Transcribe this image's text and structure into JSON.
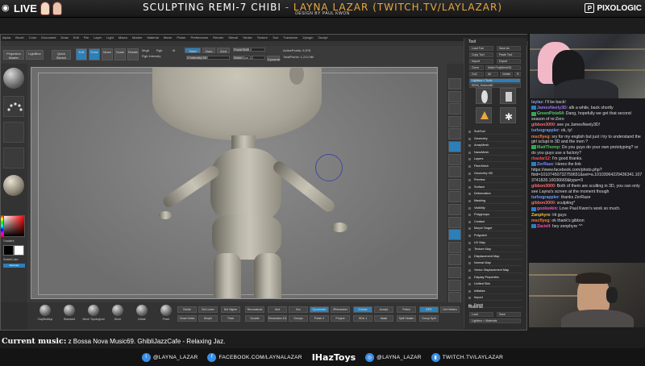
{
  "banner": {
    "live": "LIVE",
    "title_main": "SCULPTING REMI-7 CHIBI",
    "title_sep": " - ",
    "title_artist": "LAYNA LAZAR (TWITCH.TV/LAYLAZAR)",
    "subtitle": "DESIGN BY PAUL KWON",
    "sponsor": "PIXOLOGIC"
  },
  "zbrush": {
    "menu": [
      "Alpha",
      "Brush",
      "Color",
      "Document",
      "Draw",
      "Edit",
      "File",
      "Layer",
      "Light",
      "Macro",
      "Marker",
      "Material",
      "Movie",
      "Picker",
      "Preferences",
      "Render",
      "Stencil",
      "Stroke",
      "Texture",
      "Tool",
      "Transform",
      "Zplugin",
      "Zscript"
    ],
    "toolbar": {
      "projection_master": "Projection Master",
      "lightbox": "LightBox",
      "quick_sketch": "Quick Sketch",
      "edit": "Edit",
      "draw": "Draw",
      "move": "Move",
      "scale": "Scale",
      "rotate": "Rotate",
      "mrgb": "Mrgb",
      "rgb": "Rgb",
      "m": "M",
      "zadd": "Zadd",
      "zsub": "Zsub",
      "zcut": "Zcut",
      "rgb_intensity": "Rgb Intensity",
      "z_intensity": "Z Intensity 50",
      "focal_shift": "Focal Shift 0",
      "draw_size": "Draw Size 22",
      "dynamic": "Dynamic",
      "active_points": "ActivePoints: 5,578",
      "total_points": "TotalPoints: 1,212 Mil"
    },
    "tool_palette": {
      "title": "Tool",
      "buttons": [
        "Load Tool",
        "Save As",
        "Copy Tool",
        "Paste Tool",
        "Import",
        "Export",
        "Clone",
        "Make PolyMesh3D",
        "GoZ",
        "All",
        "Visible",
        "R",
        "Lightbox > Tools",
        "REMI_Subtool80"
      ],
      "items": [
        "SubTool",
        "Geometry",
        "ArrayMesh",
        "NanoMesh",
        "Layers",
        "FiberMesh",
        "Geometry HD",
        "Preview",
        "Surface",
        "Deformation",
        "Masking",
        "Visibility",
        "Polygroups",
        "Contact",
        "Morph Target",
        "Polypaint",
        "UV Map",
        "Texture Map",
        "Displacement Map",
        "Normal Map",
        "Vector Displacement Map",
        "Display Properties",
        "Unified Skin",
        "Initialize",
        "Import",
        "Export"
      ],
      "material_title": "Material",
      "material_buttons": [
        "Load",
        "Save",
        "Lightbox > Materials"
      ]
    },
    "left_tray": {
      "gradient": "Gradient",
      "switch_color": "SwitchColor",
      "alternate": "Alternate"
    },
    "bottom_tray": {
      "brushes": [
        "ClayBuildup",
        "Standard",
        "Move Topological",
        "Move",
        "Inflate",
        "Pinch"
      ],
      "buttons": [
        "Divide",
        "Del Lower",
        "Del Higher",
        "Reconstruct",
        "Smt",
        "Suv",
        "Dynamesh",
        "ZRemesher",
        "Extract",
        "Accept",
        "Polish",
        "BPR",
        "Del Hidden",
        "Close Holes",
        "Morph",
        "Thick",
        "Double",
        "Resolution 128",
        "Groups",
        "Polish 2",
        "Project",
        "SDiv 1",
        "Mask",
        "Split Hidden",
        "Group Split"
      ]
    }
  },
  "chat": [
    {
      "user": "laylaz",
      "color": "#8a9be8",
      "text": "I'll be back!",
      "badge": ""
    },
    {
      "user": "JamesNeely3D",
      "color": "#9d74e8",
      "text": "afk a while, back shortly",
      "badge": "blue"
    },
    {
      "user": "GreenPixie64",
      "color": "#4ed36b",
      "text": "Dang, hopefully we get that second season of re:Zero",
      "badge": "green"
    },
    {
      "user": "gibbon3000",
      "color": "#ff6b6b",
      "text": "see ya JamesNeely3D!",
      "badge": ""
    },
    {
      "user": "turbograppler",
      "color": "#6b9dff",
      "text": "ok, ty!",
      "badge": ""
    },
    {
      "user": "mscflyeg",
      "color": "#ff7a3d",
      "text": "sry for my english but just i try to understand the girl sclupt in 3D and the men ?",
      "badge": ""
    },
    {
      "user": "MattThomp",
      "color": "#49c35c",
      "text": "Do you guys do your own prototyping? or do you guys use a factory?",
      "badge": "green"
    },
    {
      "user": "rbazlar12",
      "color": "#ff4f4f",
      "text": "I'm good thanks.",
      "badge": ""
    },
    {
      "user": "ZerRaze",
      "color": "#7b8cff",
      "text": "Heres the link https://www.facebook.com/photo.php?fbid=10107450732759651&set=a.10103064229436341.1073741828.10036669&type=3",
      "badge": "blue"
    },
    {
      "user": "gibbon3000",
      "color": "#ff6b6b",
      "text": "Both of them are sculting in 3D, you can only see Layna's screen at the moment though",
      "badge": ""
    },
    {
      "user": "turbograppler",
      "color": "#6b9dff",
      "text": "thanks ZerRaze",
      "badge": ""
    },
    {
      "user": "gibbon3000",
      "color": "#ff6b6b",
      "text": "sculpting*",
      "badge": ""
    },
    {
      "user": "goolookin",
      "color": "#e95dbd",
      "text": "Love Paul Kwon's work so much.",
      "badge": "blue"
    },
    {
      "user": "Zanphyre",
      "color": "#e8c13e",
      "text": "Hi guys",
      "badge": ""
    },
    {
      "user": "mscflyeg",
      "color": "#ff7a3d",
      "text": "ok thank's gibbon",
      "badge": ""
    },
    {
      "user": "Zaciell",
      "color": "#ff4fb1",
      "text": "hey zenphyre ^^",
      "badge": "blue"
    }
  ],
  "music": {
    "label": "Current music:",
    "track": "z Bossa Nova Music69. GhibliJazzCafe - Relaxing Jaz."
  },
  "footer": {
    "twitter": "@LAYNA_LAZAR",
    "facebook": "FACEBOOK.COM/LAYNALAZAR",
    "logo": "IHazToys",
    "instagram": "@LAYNA_LAZAR",
    "twitch": "TWITCH.TV/LAYLAZAR"
  },
  "colors": {
    "accent": "#2c7fb8",
    "title_highlight": "#e8a83e"
  }
}
